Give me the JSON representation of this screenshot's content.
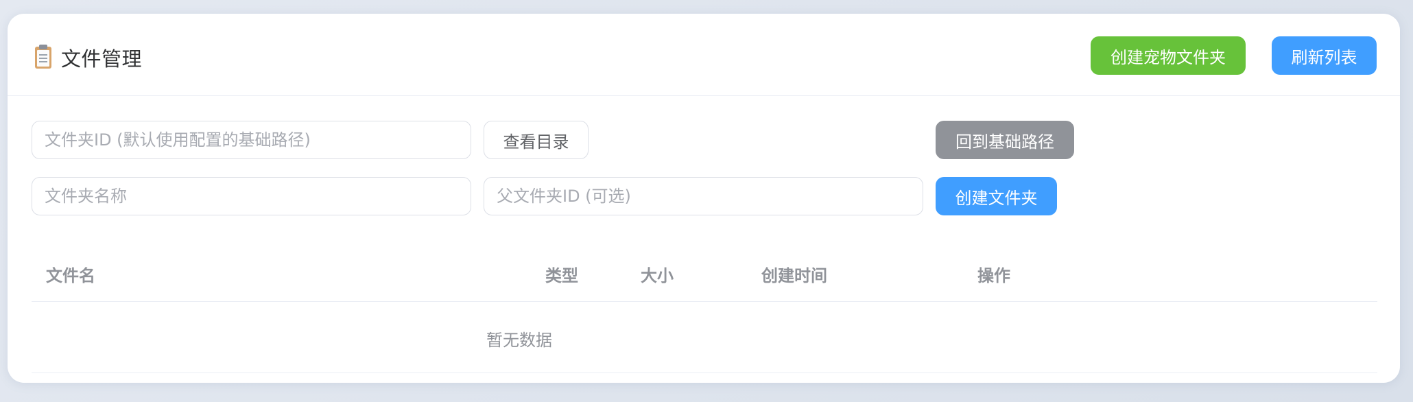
{
  "header": {
    "icon": "clipboard-icon",
    "title": "文件管理",
    "create_pet_folder_label": "创建宠物文件夹",
    "refresh_label": "刷新列表"
  },
  "browse": {
    "folder_id_placeholder": "文件夹ID (默认使用配置的基础路径)",
    "folder_id_value": "",
    "view_dir_label": "查看目录",
    "back_to_base_label": "回到基础路径"
  },
  "create": {
    "folder_name_placeholder": "文件夹名称",
    "folder_name_value": "",
    "parent_id_placeholder": "父文件夹ID (可选)",
    "parent_id_value": "",
    "create_folder_label": "创建文件夹"
  },
  "table": {
    "columns": [
      "文件名",
      "类型",
      "大小",
      "创建时间",
      "操作"
    ],
    "empty_text": "暂无数据"
  },
  "colors": {
    "green": "#67c23a",
    "blue": "#409eff",
    "gray": "#909399"
  }
}
